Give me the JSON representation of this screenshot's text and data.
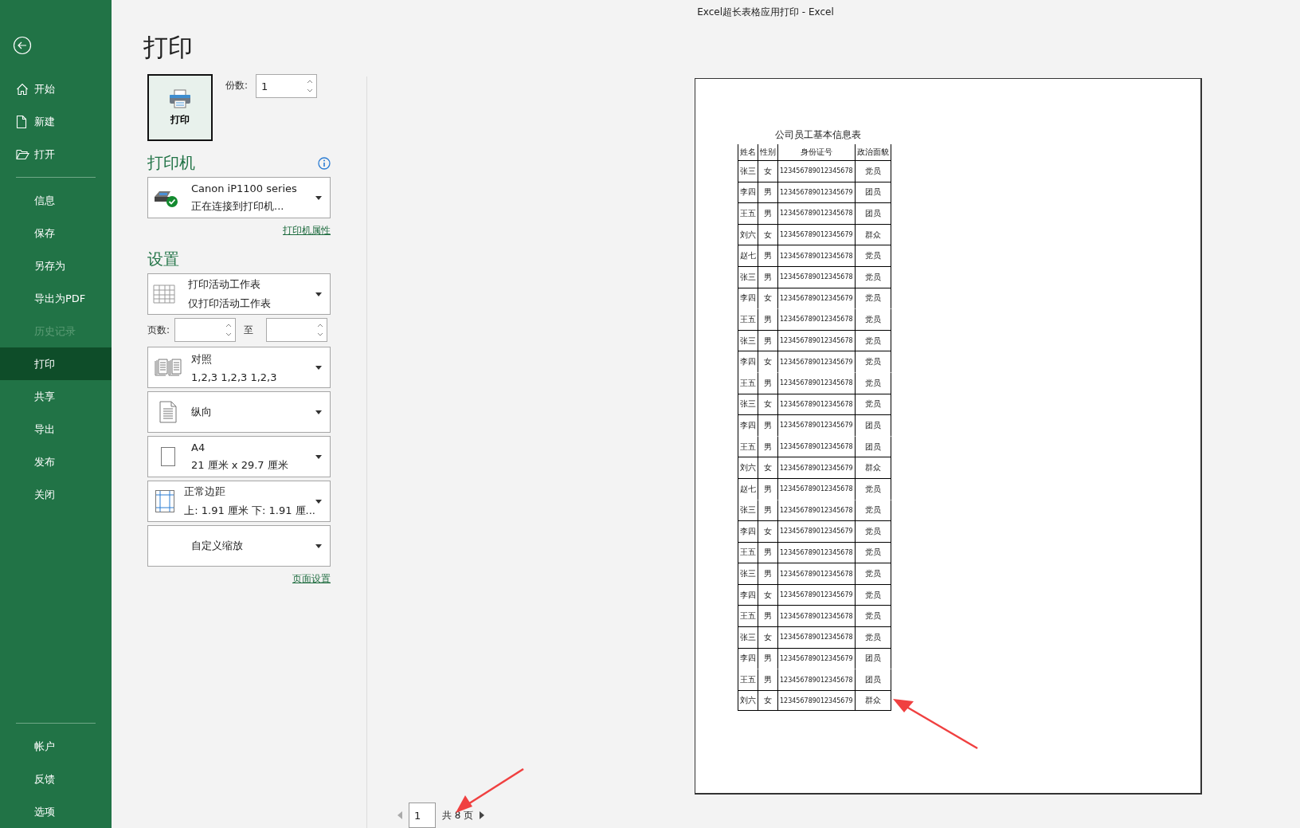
{
  "window": {
    "title": "Excel超长表格应用打印  -  Excel"
  },
  "sidebar": {
    "items": [
      {
        "label": "开始",
        "kind": "home",
        "selected": false,
        "disabled": false
      },
      {
        "label": "新建",
        "kind": "file",
        "selected": false,
        "disabled": false
      },
      {
        "label": "打开",
        "kind": "folder",
        "selected": false,
        "disabled": false
      },
      {
        "label": "信息",
        "kind": "plain",
        "selected": false,
        "disabled": false
      },
      {
        "label": "保存",
        "kind": "plain",
        "selected": false,
        "disabled": false
      },
      {
        "label": "另存为",
        "kind": "plain",
        "selected": false,
        "disabled": false
      },
      {
        "label": "导出为PDF",
        "kind": "plain",
        "selected": false,
        "disabled": false
      },
      {
        "label": "历史记录",
        "kind": "plain",
        "selected": false,
        "disabled": true
      },
      {
        "label": "打印",
        "kind": "plain",
        "selected": true,
        "disabled": false
      },
      {
        "label": "共享",
        "kind": "plain",
        "selected": false,
        "disabled": false
      },
      {
        "label": "导出",
        "kind": "plain",
        "selected": false,
        "disabled": false
      },
      {
        "label": "发布",
        "kind": "plain",
        "selected": false,
        "disabled": false
      },
      {
        "label": "关闭",
        "kind": "plain",
        "selected": false,
        "disabled": false
      }
    ],
    "footer_items": [
      {
        "label": "帐户",
        "selected": false
      },
      {
        "label": "反馈",
        "selected": false
      },
      {
        "label": "选项",
        "selected": false
      }
    ]
  },
  "print": {
    "heading": "打印",
    "button": "打印",
    "copies_label": "份数:",
    "copies_value": "1"
  },
  "printer": {
    "heading": "打印机",
    "name": "Canon iP1100 series",
    "status": "正在连接到打印机...",
    "properties_link": "打印机属性"
  },
  "settings": {
    "heading": "设置",
    "what": {
      "kind": "sheet",
      "line1": "打印活动工作表",
      "line2": "仅打印活动工作表"
    },
    "pages": {
      "label": "页数:",
      "to": "至"
    },
    "options": [
      {
        "kind": "collate",
        "line1": "对照",
        "line2": "1,2,3    1,2,3    1,2,3"
      },
      {
        "kind": "portrait",
        "line1": "纵向"
      },
      {
        "kind": "paper",
        "line1": "A4",
        "line2": "21 厘米 x 29.7 厘米"
      },
      {
        "kind": "margins",
        "line1": "正常边距",
        "line2": "上: 1.91 厘米 下: 1.91 厘..."
      },
      {
        "kind": "scaling",
        "line1": "自定义缩放"
      }
    ],
    "page_setup_link": "页面设置"
  },
  "preview": {
    "table_title": "公司员工基本信息表",
    "columns": [
      "姓名",
      "性别",
      "身份证号",
      "政治面貌"
    ],
    "rows": [
      {
        "cells": [
          "张三",
          "女",
          "123456789012345678",
          "党员"
        ],
        "divider_above": true
      },
      {
        "cells": [
          "李四",
          "男",
          "123456789012345679",
          "团员"
        ],
        "divider_above": true
      },
      {
        "cells": [
          "王五",
          "男",
          "123456789012345678",
          "团员"
        ],
        "divider_above": true
      },
      {
        "cells": [
          "刘六",
          "女",
          "123456789012345679",
          "群众"
        ],
        "divider_above": true
      },
      {
        "cells": [
          "赵七",
          "男",
          "123456789012345678",
          "党员"
        ],
        "divider_above": true
      },
      {
        "cells": [
          "张三",
          "男",
          "123456789012345678",
          "党员"
        ],
        "divider_above": true
      },
      {
        "cells": [
          "李四",
          "女",
          "123456789012345679",
          "党员"
        ],
        "divider_above": true
      },
      {
        "cells": [
          "王五",
          "男",
          "123456789012345678",
          "党员"
        ],
        "divider_above": false
      },
      {
        "cells": [
          "张三",
          "男",
          "123456789012345678",
          "党员"
        ],
        "divider_above": true
      },
      {
        "cells": [
          "李四",
          "女",
          "123456789012345679",
          "党员"
        ],
        "divider_above": true
      },
      {
        "cells": [
          "王五",
          "男",
          "123456789012345678",
          "党员"
        ],
        "divider_above": false
      },
      {
        "cells": [
          "张三",
          "女",
          "123456789012345678",
          "党员"
        ],
        "divider_above": true
      },
      {
        "cells": [
          "李四",
          "男",
          "123456789012345679",
          "团员"
        ],
        "divider_above": true
      },
      {
        "cells": [
          "王五",
          "男",
          "123456789012345678",
          "团员"
        ],
        "divider_above": false
      },
      {
        "cells": [
          "刘六",
          "女",
          "123456789012345679",
          "群众"
        ],
        "divider_above": true
      },
      {
        "cells": [
          "赵七",
          "男",
          "123456789012345678",
          "党员"
        ],
        "divider_above": true
      },
      {
        "cells": [
          "张三",
          "男",
          "123456789012345678",
          "党员"
        ],
        "divider_above": false
      },
      {
        "cells": [
          "李四",
          "女",
          "123456789012345679",
          "党员"
        ],
        "divider_above": true
      },
      {
        "cells": [
          "王五",
          "男",
          "123456789012345678",
          "党员"
        ],
        "divider_above": true
      },
      {
        "cells": [
          "张三",
          "男",
          "123456789012345678",
          "党员"
        ],
        "divider_above": true
      },
      {
        "cells": [
          "李四",
          "女",
          "123456789012345679",
          "党员"
        ],
        "divider_above": true
      },
      {
        "cells": [
          "王五",
          "男",
          "123456789012345678",
          "党员"
        ],
        "divider_above": true
      },
      {
        "cells": [
          "张三",
          "女",
          "123456789012345678",
          "党员"
        ],
        "divider_above": true
      },
      {
        "cells": [
          "李四",
          "男",
          "123456789012345679",
          "团员"
        ],
        "divider_above": true
      },
      {
        "cells": [
          "王五",
          "男",
          "123456789012345678",
          "团员"
        ],
        "divider_above": false
      },
      {
        "cells": [
          "刘六",
          "女",
          "123456789012345679",
          "群众"
        ],
        "divider_above": true
      }
    ]
  },
  "pager": {
    "current": "1",
    "total": "共 8 页"
  }
}
